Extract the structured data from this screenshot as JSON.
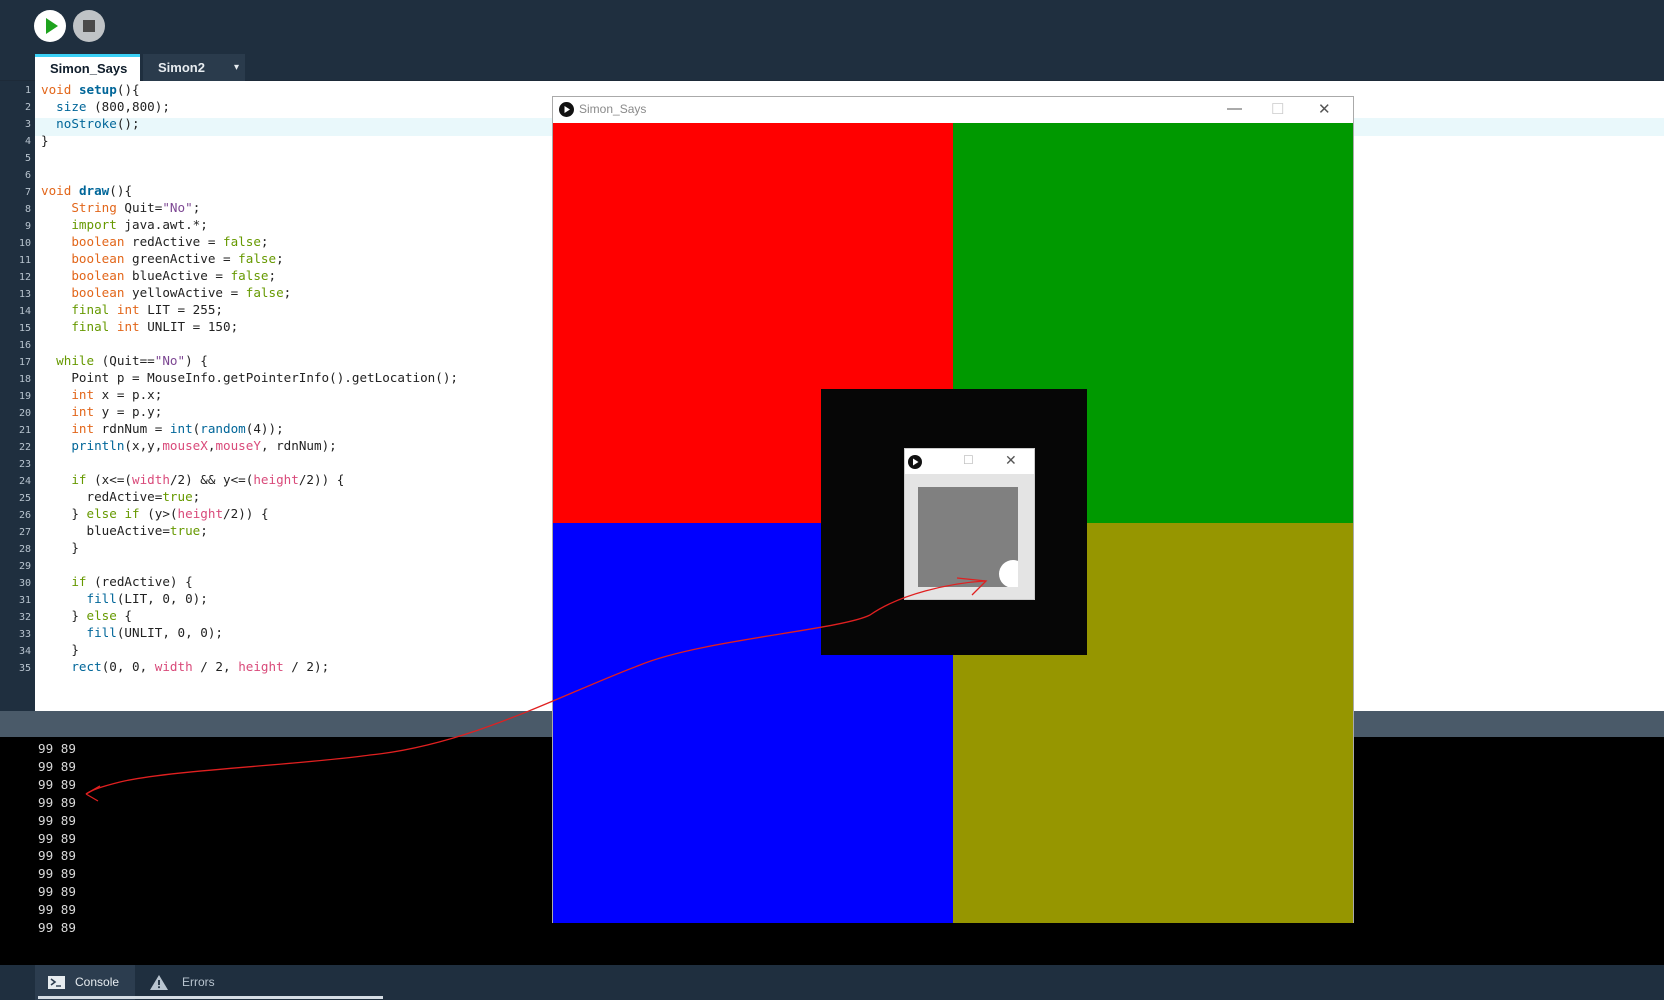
{
  "toolbar": {
    "run_icon": "play-icon",
    "stop_icon": "stop-icon"
  },
  "tabs": [
    {
      "label": "Simon_Says",
      "active": true
    },
    {
      "label": "Simon2",
      "active": false
    }
  ],
  "tab_menu": "▾",
  "editor": {
    "line_numbers": [
      "1",
      "2",
      "3",
      "4",
      "5",
      "6",
      "7",
      "8",
      "9",
      "10",
      "11",
      "12",
      "13",
      "14",
      "15",
      "16",
      "17",
      "18",
      "19",
      "20",
      "21",
      "22",
      "23",
      "24",
      "25",
      "26",
      "27",
      "28",
      "29",
      "30",
      "31",
      "32",
      "33",
      "34",
      "35"
    ],
    "highlighted_line": 3
  },
  "code": {
    "l1": {
      "a": "void",
      "b": " ",
      "c": "setup",
      "d": "(){"
    },
    "l2": {
      "a": "  ",
      "b": "size",
      "c": " (800,800);"
    },
    "l3": {
      "a": "  ",
      "b": "noStroke",
      "c": "();"
    },
    "l4": {
      "a": "}"
    },
    "l7": {
      "a": "void",
      "b": " ",
      "c": "draw",
      "d": "(){"
    },
    "l8": {
      "a": "    ",
      "b": "String",
      "c": " Quit=",
      "d": "\"No\"",
      "e": ";"
    },
    "l9": {
      "a": "    ",
      "b": "import",
      "c": " java.awt.*;"
    },
    "l10": {
      "a": "    ",
      "b": "boolean",
      "c": " redActive = ",
      "d": "false",
      "e": ";"
    },
    "l11": {
      "a": "    ",
      "b": "boolean",
      "c": " greenActive = ",
      "d": "false",
      "e": ";"
    },
    "l12": {
      "a": "    ",
      "b": "boolean",
      "c": " blueActive = ",
      "d": "false",
      "e": ";"
    },
    "l13": {
      "a": "    ",
      "b": "boolean",
      "c": " yellowActive = ",
      "d": "false",
      "e": ";"
    },
    "l14": {
      "a": "    ",
      "b": "final",
      "c": " ",
      "d": "int",
      "e": " LIT = 255;"
    },
    "l15": {
      "a": "    ",
      "b": "final",
      "c": " ",
      "d": "int",
      "e": " UNLIT = 150;"
    },
    "l17": {
      "a": "  ",
      "b": "while",
      "c": " (Quit==",
      "d": "\"No\"",
      "e": ") {"
    },
    "l18": {
      "a": "    Point p = MouseInfo.getPointerInfo().getLocation();"
    },
    "l19": {
      "a": "    ",
      "b": "int",
      "c": " x = p.x;"
    },
    "l20": {
      "a": "    ",
      "b": "int",
      "c": " y = p.y;"
    },
    "l21": {
      "a": "    ",
      "b": "int",
      "c": " rdnNum = ",
      "d": "int",
      "e": "(",
      "f": "random",
      "g": "(4));"
    },
    "l22": {
      "a": "    ",
      "b": "println",
      "c": "(x,y,",
      "d": "mouseX",
      "e": ",",
      "f": "mouseY",
      "g": ", rdnNum);"
    },
    "l24": {
      "a": "    ",
      "b": "if",
      "c": " (x<=(",
      "d": "width",
      "e": "/2) && y<=(",
      "f": "height",
      "g": "/2)) {"
    },
    "l25": {
      "a": "      redActive=",
      "b": "true",
      "c": ";"
    },
    "l26": {
      "a": "    } ",
      "b": "else",
      "c": " ",
      "d": "if",
      "e": " (y>(",
      "f": "height",
      "g": "/2)) {"
    },
    "l27": {
      "a": "      blueActive=",
      "b": "true",
      "c": ";"
    },
    "l28": {
      "a": "    }"
    },
    "l30": {
      "a": "    ",
      "b": "if",
      "c": " (redActive) {"
    },
    "l31": {
      "a": "      ",
      "b": "fill",
      "c": "(LIT, 0, 0);"
    },
    "l32": {
      "a": "    } ",
      "b": "else",
      "c": " {"
    },
    "l33": {
      "a": "      ",
      "b": "fill",
      "c": "(UNLIT, 0, 0);"
    },
    "l34": {
      "a": "    }"
    },
    "l35": {
      "a": "    ",
      "b": "rect",
      "c": "(0, 0, ",
      "d": "width",
      "e": " / 2, ",
      "f": "height",
      "g": " / 2);"
    }
  },
  "console_lines": [
    "99 89",
    "99 89",
    "99 89",
    "99 89",
    "99 89",
    "99 89",
    "99 89",
    "99 89",
    "99 89",
    "99 89",
    "99 89"
  ],
  "bottom_tabs": {
    "console": "Console",
    "errors": "Errors",
    "console_icon": "terminal-icon",
    "errors_icon": "warning-icon"
  },
  "sketch_window": {
    "title": "Simon_Says",
    "minimize": "—",
    "maximize": "☐",
    "close": "✕",
    "quadrant_colors": {
      "red": "#ff0000",
      "green": "#009900",
      "blue": "#0000ff",
      "yellow": "#969600"
    }
  },
  "mini_window": {
    "maximize": "☐",
    "close": "✕"
  },
  "annotation_color": "#e02020"
}
